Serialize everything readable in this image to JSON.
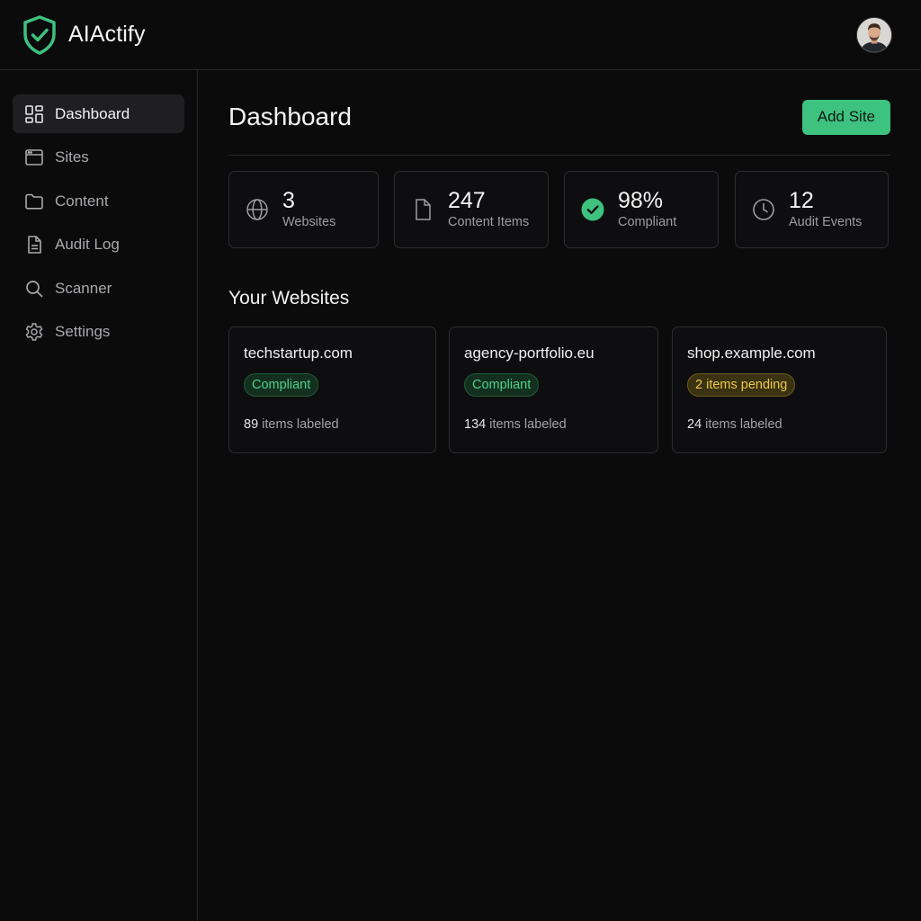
{
  "app": {
    "name": "AIActify"
  },
  "nav": [
    {
      "label": "Dashboard",
      "icon": "dashboard-icon",
      "active": true
    },
    {
      "label": "Sites",
      "icon": "browser-window-icon",
      "active": false
    },
    {
      "label": "Content",
      "icon": "folder-icon",
      "active": false
    },
    {
      "label": "Audit Log",
      "icon": "document-icon",
      "active": false
    },
    {
      "label": "Scanner",
      "icon": "search-icon",
      "active": false
    },
    {
      "label": "Settings",
      "icon": "gear-icon",
      "active": false
    }
  ],
  "main": {
    "title": "Dashboard",
    "add_button": "Add Site",
    "stats": [
      {
        "value": "3",
        "label": "Websites",
        "icon": "globe-icon"
      },
      {
        "value": "247",
        "label": "Content Items",
        "icon": "file-icon"
      },
      {
        "value": "98%",
        "label": "Compliant",
        "icon": "check-circle-icon"
      },
      {
        "value": "12",
        "label": "Audit Events",
        "icon": "clock-icon"
      }
    ],
    "websites_title": "Your Websites",
    "sites": [
      {
        "domain": "techstartup.com",
        "status": "Compliant",
        "status_type": "ok",
        "count": "89",
        "count_suffix": "items labeled"
      },
      {
        "domain": "agency-portfolio.eu",
        "status": "Compliant",
        "status_type": "ok",
        "count": "134",
        "count_suffix": "items labeled"
      },
      {
        "domain": "shop.example.com",
        "status": "2 items pending",
        "status_type": "warn",
        "count": "24",
        "count_suffix": "items labeled"
      }
    ]
  },
  "colors": {
    "accent": "#3ec27f",
    "background": "#0b0b0c",
    "warning": "#ecc94b"
  }
}
